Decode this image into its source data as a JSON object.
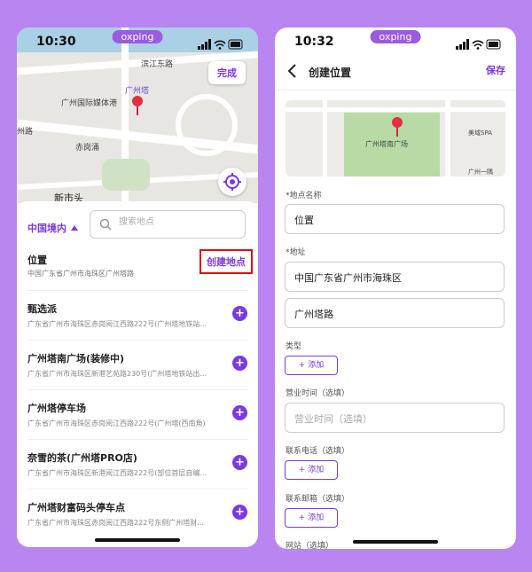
{
  "left_phone": {
    "status": {
      "time": "10:30",
      "app_pill": "oxping"
    },
    "map": {
      "labels": [
        "滨江东路",
        "广州塔",
        "广州国际媒体港",
        "赤岗涌",
        "新市头",
        "州路"
      ],
      "done_button": "完成"
    },
    "region_selector": "中国境内",
    "search": {
      "placeholder": "搜索地点"
    },
    "current_location": {
      "title": "位置",
      "address": "中国广东省广州市海珠区广州塔路"
    },
    "create_button": "创建地点",
    "places": [
      {
        "name": "甄选派",
        "address": "广东省广州市海珠区赤岗阅江西路222号(广州塔地铁站..."
      },
      {
        "name": "广州塔南广场(装修中)",
        "address": "广东省广州市海珠区新港艺苑路230号(广州塔地铁站出..."
      },
      {
        "name": "广州塔停车场",
        "address": "广东省广州市海珠区赤岗阅江西路222号(广州塔(西南角)"
      },
      {
        "name": "奈雪的茶(广州塔PRO店)",
        "address": "广东省广州市海珠区新港阅江西路222号(部位首层自编..."
      },
      {
        "name": "广州塔财富码头停车点",
        "address": "广东省广州市海珠区赤岗阅江西路222号东侧广州塔财..."
      }
    ]
  },
  "right_phone": {
    "status": {
      "time": "10:32",
      "app_pill": "oxping"
    },
    "nav": {
      "title": "创建位置",
      "save": "保存"
    },
    "map": {
      "labels": [
        "广州塔南广场",
        "美域SPA",
        "广州一隅"
      ]
    },
    "form": {
      "name_label": "*地点名称",
      "name_value": "位置",
      "address_label": "*地址",
      "address_line1": "中国广东省广州市海珠区",
      "address_line2": "广州塔路",
      "category_label": "类型",
      "add_label": "+ 添加",
      "hours_label": "营业时间（选填）",
      "hours_placeholder": "营业时间（选填）",
      "phone_label": "联系电话（选填）",
      "email_label": "联系邮箱（选填）",
      "website_label": "网站（选填）"
    }
  },
  "colors": {
    "accent": "#7b3ae0",
    "background": "#b985f0",
    "highlight_border": "#dd1111",
    "pin": "#e03040"
  }
}
